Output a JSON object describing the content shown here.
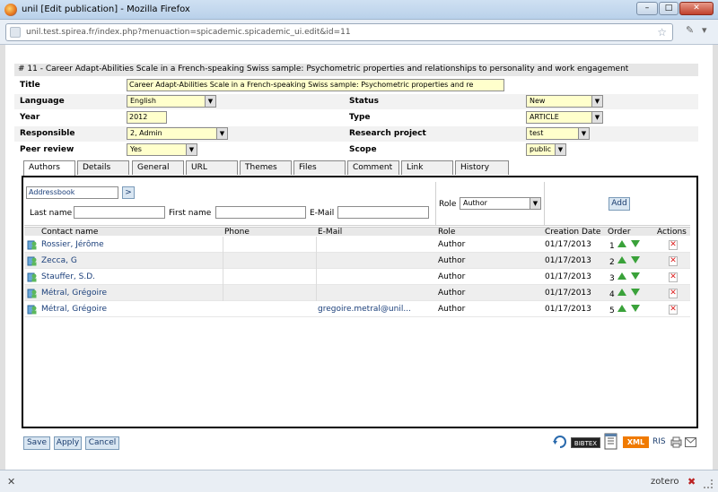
{
  "window": {
    "title": "unil [Edit publication] - Mozilla Firefox",
    "url": "unil.test.spirea.fr/index.php?menuaction=spicademic.spicademic_ui.edit&id=11",
    "min_label": "–",
    "max_label": "□",
    "close_label": "✕"
  },
  "publication": {
    "header": "# 11 - Career Adapt-Abilities Scale in a French-speaking Swiss sample: Psychometric properties and relationships to personality and work engagement",
    "title_label": "Title",
    "title_value": "Career Adapt-Abilities Scale in a French-speaking Swiss sample: Psychometric properties and re",
    "language_label": "Language",
    "language_value": "English",
    "status_label": "Status",
    "status_value": "New",
    "year_label": "Year",
    "year_value": "2012",
    "type_label": "Type",
    "type_value": "ARTICLE",
    "responsible_label": "Responsible",
    "responsible_value": "2, Admin",
    "research_project_label": "Research project",
    "research_project_value": "test",
    "peer_review_label": "Peer review",
    "peer_review_value": "Yes",
    "scope_label": "Scope",
    "scope_value": "public"
  },
  "tabs": [
    "Authors",
    "Details",
    "General",
    "URL",
    "Themes",
    "Files",
    "Comment",
    "Link",
    "History"
  ],
  "authors_panel": {
    "addressbook_value": "Addressbook",
    "go_label": ">",
    "last_name_label": "Last name",
    "first_name_label": "First name",
    "email_label": "E-Mail",
    "role_label": "Role",
    "role_value": "Author",
    "add_label": "Add",
    "columns": [
      "Contact name",
      "Phone",
      "E-Mail",
      "Role",
      "Creation Date",
      "Order",
      "Actions"
    ],
    "rows": [
      {
        "name": "Rossier, Jérôme",
        "phone": "",
        "email": "",
        "role": "Author",
        "date": "01/17/2013",
        "order": "1"
      },
      {
        "name": "Zecca, G",
        "phone": "",
        "email": "",
        "role": "Author",
        "date": "01/17/2013",
        "order": "2"
      },
      {
        "name": "Stauffer, S.D.",
        "phone": "",
        "email": "",
        "role": "Author",
        "date": "01/17/2013",
        "order": "3"
      },
      {
        "name": "Métral, Grégoire",
        "phone": "",
        "email": "",
        "role": "Author",
        "date": "01/17/2013",
        "order": "4"
      },
      {
        "name": "Métral, Grégoire",
        "phone": "",
        "email": "gregoire.metral@unil...",
        "role": "Author",
        "date": "01/17/2013",
        "order": "5"
      }
    ]
  },
  "footer": {
    "save_label": "Save",
    "apply_label": "Apply",
    "cancel_label": "Cancel",
    "bibtex_label": "BIBTEX",
    "xml_label": "XML",
    "ris_label": "RIS"
  },
  "statusbar": {
    "zotero_label": "zotero"
  }
}
